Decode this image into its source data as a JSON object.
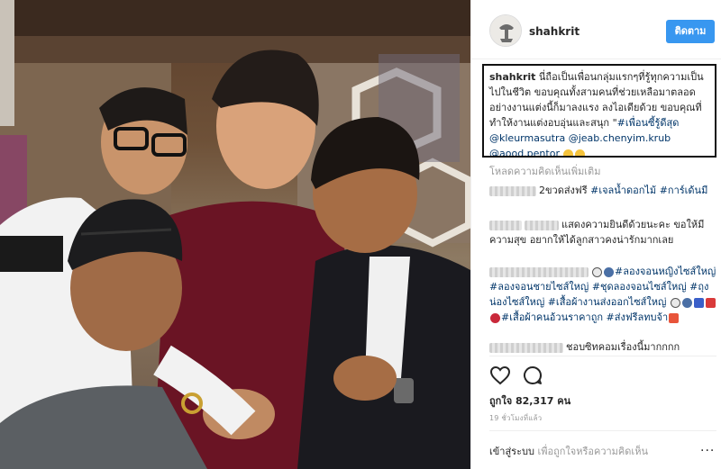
{
  "post": {
    "username": "shahkrit",
    "follow_label": "ติดตาม",
    "caption": {
      "username": "shahkrit",
      "text": "นี่ถือเป็นเพื่อนกลุ่มแรกๆที่รู้ทุกความเป็นไปในชีวิต ขอบคุณทั้งสามคนที่ช่วยเหลือมาตลอด อย่างงานแต่งนี้ก็มาลงแรง ลงไอเดียด้วย ขอบคุณที่ทำให้งานแต่งอบอุ่นและสนุก \"",
      "hashtag": "#เพื่อนซี้รู้ดีสุด",
      "mentions": [
        "@kleurmasutra",
        "@jeab.chenyim.krub",
        "@aood.pentor"
      ]
    },
    "load_more": "โหลดความคิดเห็นเพิ่มเติม",
    "comments": [
      {
        "text": "2ขวดส่งฟรี ",
        "tags": [
          "#เจลน้ำดอกไม้",
          "#การ์เด้นมี"
        ]
      },
      {
        "text": "แสดงความยินดีด้วยนะคะ ขอให้มีความสุข อยากให้ได้ลูกสาวคงน่ารักมากเลย",
        "tags": []
      },
      {
        "text": "",
        "tags": [
          "#ลองจอนหญิงไซส์ใหญ่",
          "#ลองจอนชายไซส์ใหญ่",
          "#ชุดลองจอนไซส์ใหญ่",
          "#ถุงน่องไซส์ใหญ่",
          "#เสื้อผ้างานส่งออกไซส์ใหญ่",
          "#เสื้อผ้าคนอ้วนราคาถูก",
          "#ส่งฟรีลทบจ้า"
        ]
      },
      {
        "text": "ชอบซิทคอมเรื่องนี้มากกกก",
        "tags": []
      }
    ],
    "likes": "ถูกใจ 82,317 คน",
    "time_ago": "19 ชั่วโมงที่แล้ว",
    "login_link": "เข้าสู่ระบบ",
    "login_prompt": " เพื่อถูกใจหรือความคิดเห็น",
    "more_label": "..."
  },
  "colors": {
    "link": "#003569",
    "button": "#3897f0",
    "muted": "#999999"
  },
  "icons": [
    "heart-icon",
    "comment-icon",
    "more-icon"
  ]
}
